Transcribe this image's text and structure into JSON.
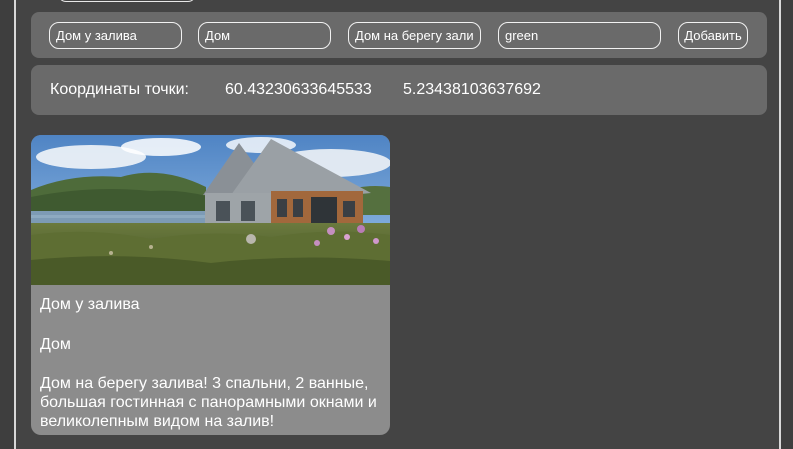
{
  "form": {
    "title_value": "Дом у залива",
    "type_value": "Дом",
    "description_value": "Дом на берегу залива! 3 спальни, 2 ванные, большая гостинная с панорамными окнами и великолепным видом на залив!",
    "color_value": "green",
    "add_label": "Добавить"
  },
  "coords": {
    "label": "Координаты точки:",
    "lat": "60.43230633645533",
    "lng": "5.23438103637692"
  },
  "card": {
    "title": "Дом у залива",
    "type": "Дом",
    "description": "Дом на берегу залива! 3 спальни, 2 ванные, большая гостинная с панорамными окнами и великолепным видом на залив!"
  }
}
